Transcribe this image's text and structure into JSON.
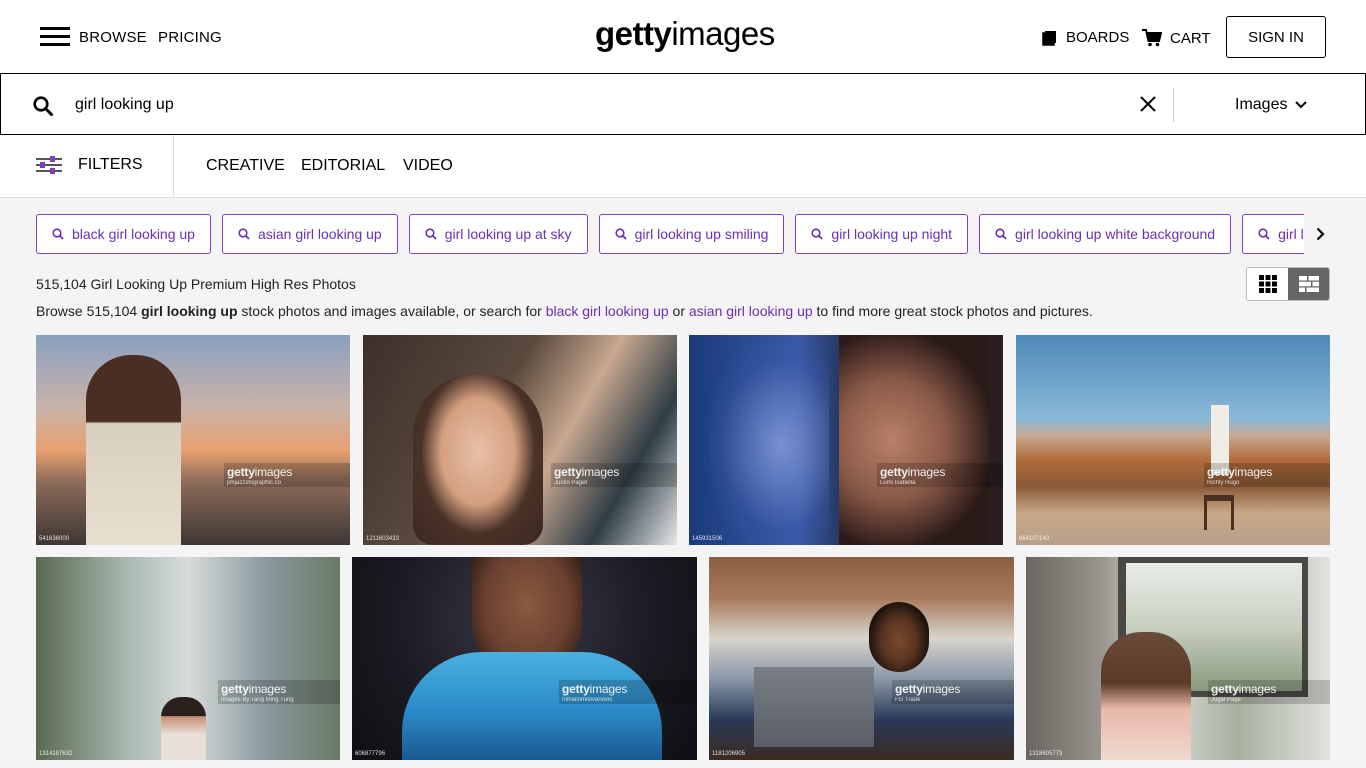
{
  "header": {
    "nav": {
      "browse": "BROWSE",
      "pricing": "PRICING"
    },
    "logo": {
      "bold": "getty",
      "light": "images"
    },
    "boards": "BOARDS",
    "cart": "CART",
    "signin": "SIGN IN"
  },
  "search": {
    "query": "girl looking up",
    "type": "Images"
  },
  "filterbar": {
    "filters_label": "FILTERS",
    "tabs": [
      "CREATIVE",
      "EDITORIAL",
      "VIDEO"
    ]
  },
  "chips": [
    "black girl looking up",
    "asian girl looking up",
    "girl looking up at sky",
    "girl looking up smiling",
    "girl looking up night",
    "girl looking up white background",
    "girl looking up stock"
  ],
  "results": {
    "title": "515,104 Girl Looking Up Premium High Res Photos",
    "desc_prefix": "Browse 515,104 ",
    "desc_query": "girl looking up",
    "desc_middle": " stock photos and images available, or search for ",
    "desc_link1": "black girl looking up",
    "desc_or": " or ",
    "desc_link2": "asian girl looking up",
    "desc_suffix": " to find more great stock photos and pictures."
  },
  "watermark": {
    "bold": "getty",
    "light": "images"
  },
  "photos": [
    {
      "id": "541636000",
      "credit": "jimjazzstographic.co"
    },
    {
      "id": "1211603433",
      "credit": "Justin Paget"
    },
    {
      "id": "145931506",
      "credit": "Lumi Isabella"
    },
    {
      "id": "864107140",
      "credit": "Richly Hugo"
    },
    {
      "id": "1314187632",
      "credit": "Images By Tang Ming Tung"
    },
    {
      "id": "606877796",
      "credit": "mihailomilovanovic"
    },
    {
      "id": "1181206905",
      "credit": "FG Trade"
    },
    {
      "id": "1318605773",
      "credit": "Jugal Page"
    }
  ],
  "colors": {
    "accent": "#6b2fb3",
    "text": "#000000",
    "page_bg": "#f4f4f4"
  }
}
